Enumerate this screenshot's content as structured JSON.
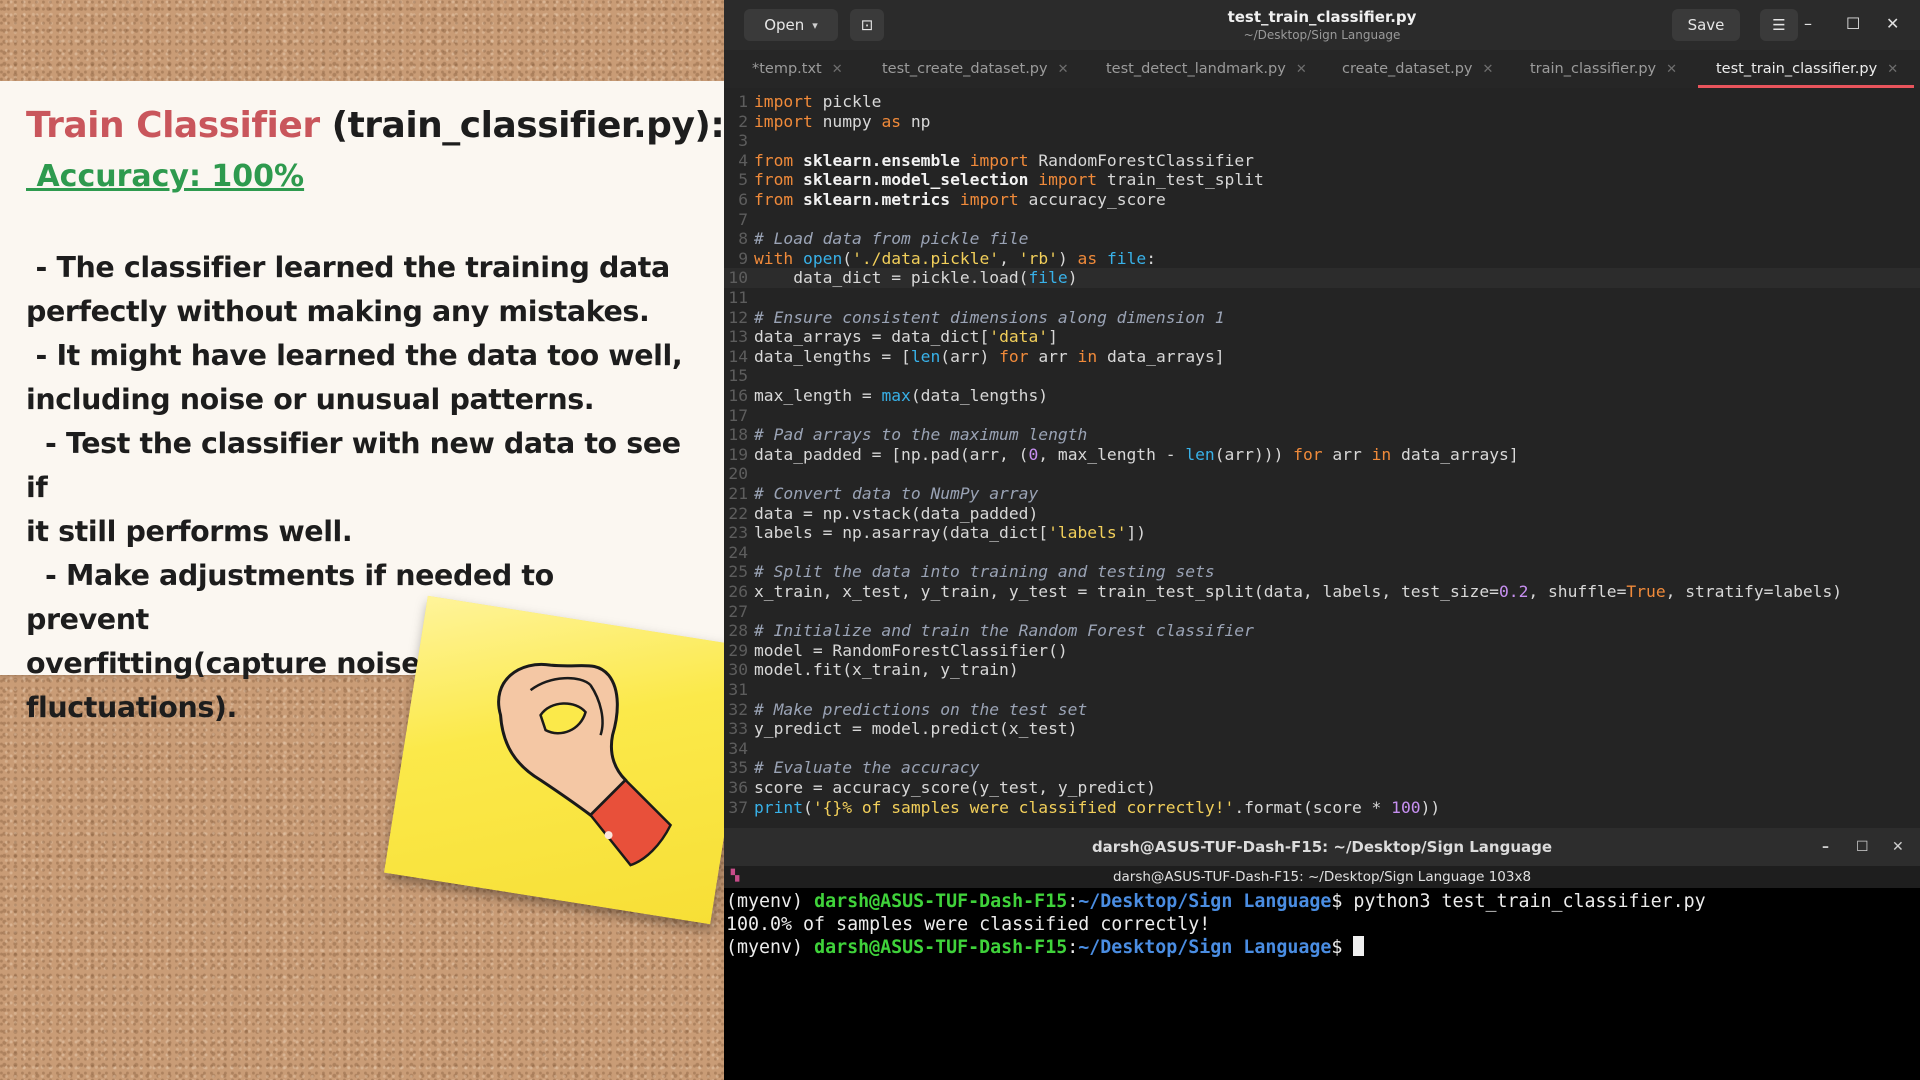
{
  "note": {
    "title_accent": "Train Classifier",
    "title_rest": " (train_classifier.py):",
    "accuracy": " Accuracy: 100%",
    "bullets": [
      " - The classifier learned the training data\nperfectly without making any mistakes.",
      " - It might have learned the data too well,\nincluding noise or unusual patterns.",
      "  - Test the classifier with new data to see if\nit still performs well.",
      "  - Make adjustments if needed to prevent\noverfitting(capture noise or random\nfluctuations)."
    ]
  },
  "editor": {
    "open_label": "Open",
    "title": "test_train_classifier.py",
    "subtitle": "~/Desktop/Sign Language",
    "save_label": "Save",
    "tabs": [
      {
        "label": "*temp.txt",
        "active": false
      },
      {
        "label": "test_create_dataset.py",
        "active": false
      },
      {
        "label": "test_detect_landmark.py",
        "active": false
      },
      {
        "label": "create_dataset.py",
        "active": false
      },
      {
        "label": "train_classifier.py",
        "active": false
      },
      {
        "label": "test_train_classifier.py",
        "active": true
      }
    ],
    "current_line": 10,
    "code": [
      "import pickle",
      "import numpy as np",
      "",
      "from sklearn.ensemble import RandomForestClassifier",
      "from sklearn.model_selection import train_test_split",
      "from sklearn.metrics import accuracy_score",
      "",
      "# Load data from pickle file",
      "with open('./data.pickle', 'rb') as file:",
      "    data_dict = pickle.load(file)",
      "",
      "# Ensure consistent dimensions along dimension 1",
      "data_arrays = data_dict['data']",
      "data_lengths = [len(arr) for arr in data_arrays]",
      "",
      "max_length = max(data_lengths)",
      "",
      "# Pad arrays to the maximum length",
      "data_padded = [np.pad(arr, (0, max_length - len(arr))) for arr in data_arrays]",
      "",
      "# Convert data to NumPy array",
      "data = np.vstack(data_padded)",
      "labels = np.asarray(data_dict['labels'])",
      "",
      "# Split the data into training and testing sets",
      "x_train, x_test, y_train, y_test = train_test_split(data, labels, test_size=0.2, shuffle=True, stratify=labels)",
      "",
      "# Initialize and train the Random Forest classifier",
      "model = RandomForestClassifier()",
      "model.fit(x_train, y_train)",
      "",
      "# Make predictions on the test set",
      "y_predict = model.predict(x_test)",
      "",
      "# Evaluate the accuracy",
      "score = accuracy_score(y_test, y_predict)",
      "print('{}% of samples were classified correctly!'.format(score * 100))"
    ]
  },
  "terminal": {
    "title": "darsh@ASUS-TUF-Dash-F15: ~/Desktop/Sign Language",
    "tab_label": "darsh@ASUS-TUF-Dash-F15: ~/Desktop/Sign Language 103x8",
    "env": "(myenv) ",
    "user_host": "darsh@ASUS-TUF-Dash-F15",
    "path": "~/Desktop/Sign Language",
    "command": "python3 test_train_classifier.py",
    "output": "100.0% of samples were classified correctly!"
  }
}
